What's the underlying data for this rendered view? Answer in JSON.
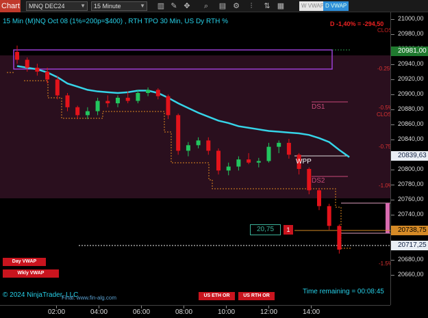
{
  "toolbar": {
    "tab_label": "Chart",
    "symbol": "MNQ DEC24",
    "timeframe": "15 Minute",
    "btn_wvwap": "W VWAP",
    "btn_dvwap": "D VWAP"
  },
  "chart": {
    "title": "15 Min (M)NQ Oct 08 (1%=200p=$400) , RTH TPO 30 Min, US Dy RTH %",
    "pl_text": "D -1,40% = -294,50",
    "close_label": "CLOSE",
    "close_label2": "CLOSE",
    "pct_025": "-0.25%",
    "pct_05": "-0.5%",
    "pct_075": "-0.75%",
    "pct_1": "-1.0%",
    "pct_15": "-1.5%",
    "ds1": "DS1",
    "ds2": "DS2",
    "wpp": "WPP",
    "copyright": "© 2024 NinjaTrader, LLC",
    "source": "Final: www.fin-alg.com",
    "time_remaining": "Time remaining = 00:08:45",
    "qty": "20,75",
    "qty_badge": "1",
    "btn_day_vwap": "Day VWAP",
    "btn_wkly_vwap": "Wkly VWAP",
    "btn_us_eth": "US ETH OR",
    "btn_us_rth": "US RTH OR"
  },
  "price_axis": {
    "ticks": [
      "21000,00",
      "20980,00",
      "20960,00",
      "20940,00",
      "20920,00",
      "20900,00",
      "20880,00",
      "20860,00",
      "20840,00",
      "20820,00",
      "20800,00",
      "20780,00",
      "20760,00",
      "20740,00",
      "20720,00",
      "20700,00",
      "20680,00",
      "20660,00"
    ],
    "box_top": "20981,00",
    "box_mid": "20839,63",
    "box_low": "20738,75",
    "box_last": "20717,25"
  },
  "time_axis": {
    "labels": [
      "02:00",
      "04:00",
      "06:00",
      "08:00",
      "10:00",
      "12:00",
      "14:00"
    ]
  },
  "colors": {
    "up": "#22c55e",
    "down": "#e3131b",
    "vwap": "#36d4e8",
    "zone": "#2a0f1e",
    "accent": "#27d0e8"
  },
  "chart_data": {
    "type": "candlestick",
    "ylim": [
      20650,
      21020
    ],
    "vwap": [
      20952,
      20950,
      20948,
      20944,
      20938,
      20930,
      20926,
      20922,
      20920,
      20919,
      20918,
      20919,
      20921,
      20921,
      20918,
      20912,
      20905,
      20899,
      20893,
      20888,
      20883,
      20880,
      20876,
      20874,
      20872,
      20870,
      20869,
      20868,
      20867,
      20865,
      20861,
      20856,
      20846,
      20837
    ],
    "candles": [
      [
        20970,
        20978,
        20955,
        20960
      ],
      [
        20960,
        20963,
        20945,
        20950
      ],
      [
        20950,
        20955,
        20940,
        20945
      ],
      [
        20945,
        20950,
        20930,
        20935
      ],
      [
        20935,
        20940,
        20910,
        20915
      ],
      [
        20915,
        20918,
        20895,
        20900
      ],
      [
        20900,
        20902,
        20885,
        20890
      ],
      [
        20890,
        20900,
        20885,
        20895
      ],
      [
        20895,
        20912,
        20890,
        20908
      ],
      [
        20908,
        20915,
        20900,
        20905
      ],
      [
        20905,
        20915,
        20900,
        20912
      ],
      [
        20912,
        20920,
        20905,
        20908
      ],
      [
        20908,
        20922,
        20905,
        20918
      ],
      [
        20918,
        20925,
        20914,
        20922
      ],
      [
        20922,
        20924,
        20910,
        20914
      ],
      [
        20914,
        20916,
        20885,
        20890
      ],
      [
        20890,
        20892,
        20840,
        20845
      ],
      [
        20845,
        20856,
        20838,
        20852
      ],
      [
        20852,
        20862,
        20848,
        20858
      ],
      [
        20858,
        20862,
        20840,
        20845
      ],
      [
        20845,
        20848,
        20815,
        20820
      ],
      [
        20820,
        20830,
        20814,
        20825
      ],
      [
        20825,
        20838,
        20820,
        20834
      ],
      [
        20834,
        20842,
        20828,
        20830
      ],
      [
        20830,
        20836,
        20824,
        20832
      ],
      [
        20832,
        20855,
        20830,
        20850
      ],
      [
        20850,
        20858,
        20842,
        20855
      ],
      [
        20855,
        20860,
        20835,
        20840
      ],
      [
        20840,
        20842,
        20815,
        20822
      ],
      [
        20822,
        20824,
        20790,
        20795
      ],
      [
        20795,
        20798,
        20770,
        20775
      ],
      [
        20775,
        20778,
        20745,
        20750
      ],
      [
        20750,
        20752,
        20715,
        20720
      ]
    ]
  }
}
